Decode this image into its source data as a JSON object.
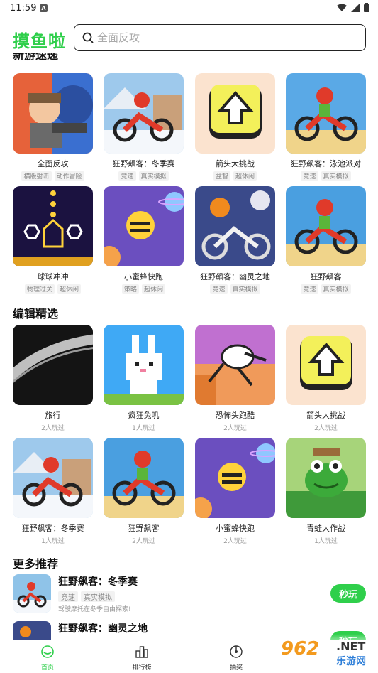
{
  "status": {
    "time": "11:59",
    "a_badge": "A"
  },
  "header": {
    "logo": "摸鱼啦",
    "search_placeholder": "全面反攻"
  },
  "sections": {
    "new_games": "新游速递",
    "editor_picks": "编辑精选",
    "more": "更多推荐"
  },
  "new_games": [
    {
      "name": "全面反攻",
      "tags": [
        "横版射击",
        "动作冒险"
      ],
      "icon": "gunner-icon"
    },
    {
      "name": "狂野飙客：冬季赛",
      "tags": [
        "竞速",
        "真实模拟"
      ],
      "icon": "winter-bike-icon"
    },
    {
      "name": "箭头大挑战",
      "tags": [
        "益智",
        "超休闲"
      ],
      "icon": "arrow-up-icon"
    },
    {
      "name": "狂野飙客：泳池派对",
      "tags": [
        "竞速",
        "真实模拟"
      ],
      "icon": "pool-bike-icon"
    },
    {
      "name": "球球冲冲",
      "tags": [
        "物理过关",
        "超休闲"
      ],
      "icon": "ball-drop-icon"
    },
    {
      "name": "小蜜蜂快跑",
      "tags": [
        "策略",
        "超休闲"
      ],
      "icon": "bee-icon"
    },
    {
      "name": "狂野飙客：幽灵之地",
      "tags": [
        "竞速",
        "真实模拟"
      ],
      "icon": "ghost-bike-icon"
    },
    {
      "name": "狂野飙客",
      "tags": [
        "竞速",
        "真实模拟"
      ],
      "icon": "desert-bike-icon"
    }
  ],
  "editor_picks": [
    {
      "name": "旅行",
      "plays": "2人玩过",
      "icon": "brush-stroke-icon"
    },
    {
      "name": "疯狂兔叽",
      "plays": "1人玩过",
      "icon": "rabbit-icon"
    },
    {
      "name": "恐怖头跑酷",
      "plays": "2人玩过",
      "icon": "runner-icon"
    },
    {
      "name": "箭头大挑战",
      "plays": "2人玩过",
      "icon": "arrow-up-icon"
    },
    {
      "name": "狂野飙客：冬季赛",
      "plays": "1人玩过",
      "icon": "winter-bike-icon"
    },
    {
      "name": "狂野飙客",
      "plays": "2人玩过",
      "icon": "desert-bike-icon"
    },
    {
      "name": "小蜜蜂快跑",
      "plays": "2人玩过",
      "icon": "bee-icon"
    },
    {
      "name": "青蛙大作战",
      "plays": "1人玩过",
      "icon": "frog-icon"
    }
  ],
  "more_list": [
    {
      "name": "狂野飙客：冬季赛",
      "tags": [
        "竞速",
        "真实模拟"
      ],
      "desc": "驾驶摩托在冬季自由探索!",
      "button": "秒玩"
    },
    {
      "name": "狂野飙客：幽灵之地",
      "tags": [],
      "desc": "",
      "button": "秒玩"
    }
  ],
  "tabs": [
    {
      "label": "首页",
      "icon": "home-icon",
      "active": true
    },
    {
      "label": "排行榜",
      "icon": "ranking-icon",
      "active": false
    },
    {
      "label": "抽奖",
      "icon": "lottery-icon",
      "active": false
    }
  ],
  "watermark": {
    "logo": "962",
    "net": ".NET",
    "cn": "乐游网"
  },
  "colors": {
    "accent": "#2fcf4b"
  }
}
